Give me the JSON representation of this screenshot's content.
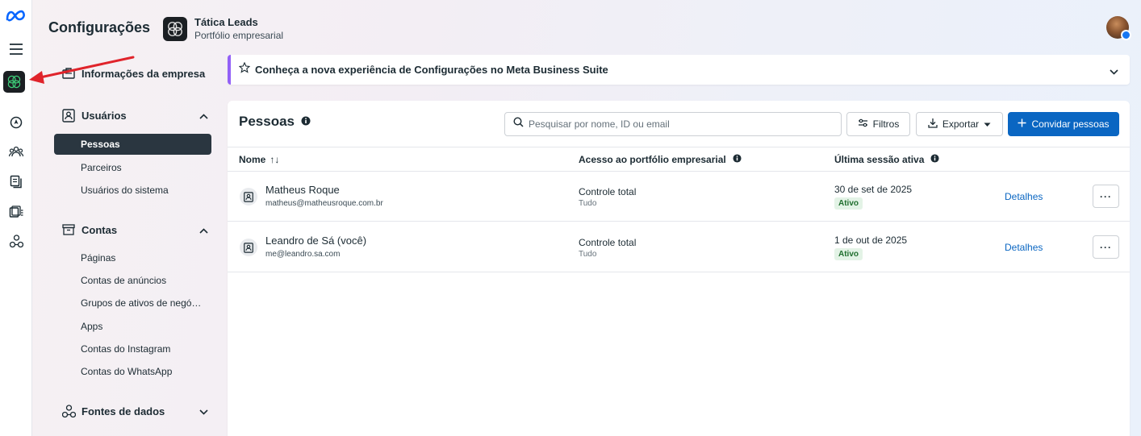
{
  "header": {
    "title": "Configurações",
    "portfolio_name": "Tática Leads",
    "portfolio_sub": "Portfólio empresarial"
  },
  "rail": {
    "icons": [
      "meta-logo-icon",
      "menu-icon",
      "portfolio-icon",
      "compass-icon",
      "people-icon",
      "documents-icon",
      "accounts-icon",
      "data-sources-icon"
    ]
  },
  "sidebar": {
    "company_info": "Informações da empresa",
    "users_section": "Usuários",
    "users_items": [
      "Pessoas",
      "Parceiros",
      "Usuários do sistema"
    ],
    "accounts_section": "Contas",
    "accounts_items": [
      "Páginas",
      "Contas de anúncios",
      "Grupos de ativos de negó…",
      "Apps",
      "Contas do Instagram",
      "Contas do WhatsApp"
    ],
    "data_sources_section": "Fontes de dados"
  },
  "banner": {
    "text": "Conheça a nova experiência de Configurações no Meta Business Suite"
  },
  "people": {
    "title": "Pessoas",
    "search_placeholder": "Pesquisar por nome, ID ou email",
    "filters_label": "Filtros",
    "export_label": "Exportar",
    "invite_label": "Convidar pessoas",
    "columns": {
      "name": "Nome",
      "sort_glyph": "↑↓",
      "access": "Acesso ao portfólio empresarial",
      "last_session": "Última sessão ativa"
    },
    "rows": [
      {
        "name": "Matheus Roque",
        "email": "matheus@matheusroque.com.br",
        "access": "Controle total",
        "access_sub": "Tudo",
        "date": "30 de set de 2025",
        "status": "Ativo",
        "details": "Detalhes",
        "more": "···"
      },
      {
        "name": "Leandro de Sá (você)",
        "email": "me@leandro.sa.com",
        "access": "Controle total",
        "access_sub": "Tudo",
        "date": "1 de out de 2025",
        "status": "Ativo",
        "details": "Detalhes",
        "more": "···"
      }
    ]
  },
  "colors": {
    "accent": "#0a66c2",
    "banner_border": "#9360f7",
    "active_nav": "#2a3640",
    "annotation_arrow": "#e0242b",
    "status_green": "#1f6e2e"
  }
}
